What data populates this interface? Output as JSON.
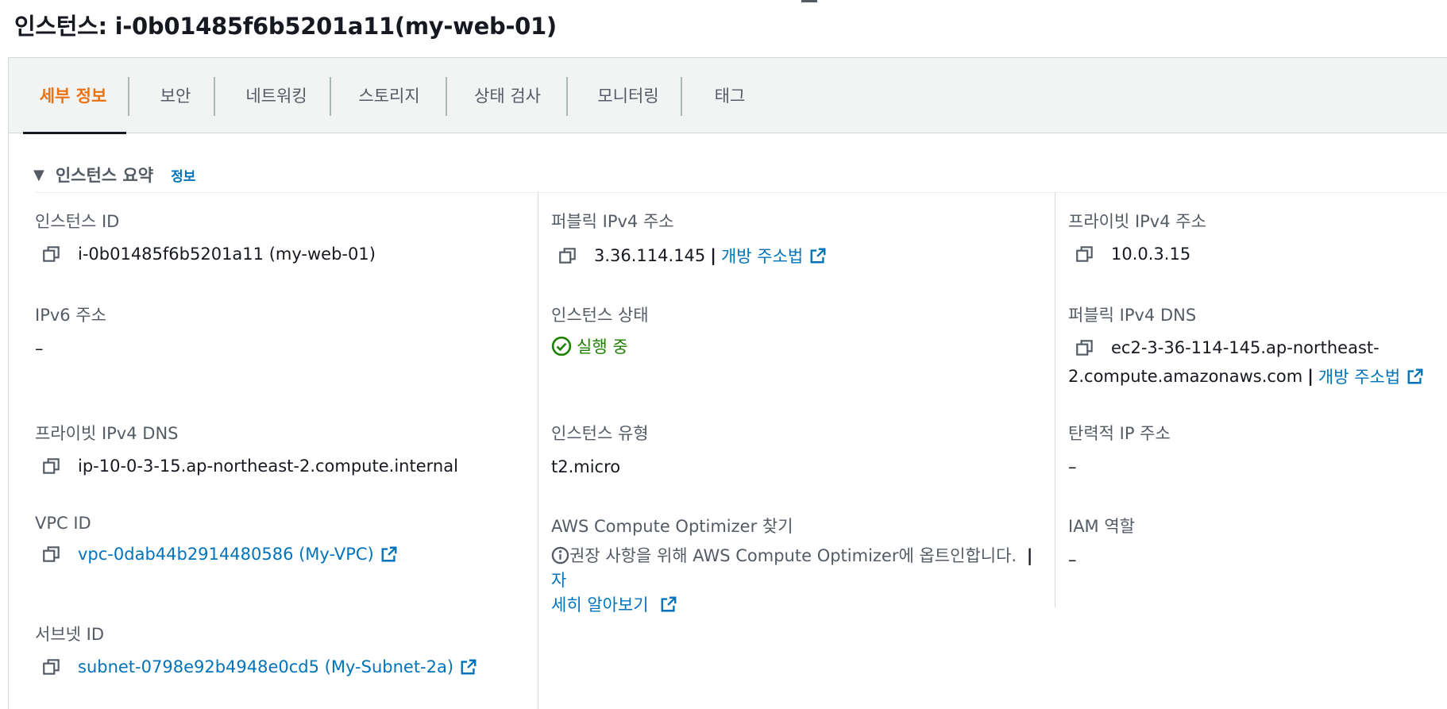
{
  "page": {
    "title": "인스턴스: i-0b01485f6b5201a11(my-web-01)"
  },
  "tabs": [
    {
      "label": "세부 정보",
      "active": true
    },
    {
      "label": "보안"
    },
    {
      "label": "네트워킹"
    },
    {
      "label": "스토리지"
    },
    {
      "label": "상태 검사"
    },
    {
      "label": "모니터링"
    },
    {
      "label": "태그"
    }
  ],
  "summary": {
    "title": "인스턴스 요약",
    "info_link": "정보"
  },
  "fields": {
    "instance_id": {
      "label": "인스턴스 ID",
      "value": "i-0b01485f6b5201a11 (my-web-01)"
    },
    "public_ipv4": {
      "label": "퍼블릭 IPv4 주소",
      "value": "3.36.114.145",
      "sep": "|",
      "link": "개방 주소법"
    },
    "private_ipv4": {
      "label": "프라이빗 IPv4 주소",
      "value": "10.0.3.15"
    },
    "ipv6": {
      "label": "IPv6 주소",
      "value": "–"
    },
    "instance_state": {
      "label": "인스턴스 상태",
      "value": "실행 중"
    },
    "public_dns": {
      "label": "퍼블릭 IPv4 DNS",
      "value_line1": "ec2-3-36-114-145.ap-northeast-",
      "value_line2": "2.compute.amazonaws.com",
      "sep": "|",
      "link": "개방 주소법"
    },
    "private_dns": {
      "label": "프라이빗 IPv4 DNS",
      "value": "ip-10-0-3-15.ap-northeast-2.compute.internal"
    },
    "instance_type": {
      "label": "인스턴스 유형",
      "value": "t2.micro"
    },
    "elastic_ip": {
      "label": "탄력적 IP 주소",
      "value": "–"
    },
    "vpc_id": {
      "label": "VPC ID",
      "value": "vpc-0dab44b2914480586 (My-VPC)"
    },
    "optimizer": {
      "label": "AWS Compute Optimizer 찾기",
      "text": "권장 사항을 위해 AWS Compute Optimizer에 옵트인합니다.",
      "sep": "|",
      "link_part1": "자",
      "link_part2": "세히 알아보기"
    },
    "iam_role": {
      "label": "IAM 역할",
      "value": "–"
    },
    "subnet_id": {
      "label": "서브넷 ID",
      "value": "subnet-0798e92b4948e0cd5 (My-Subnet-2a)"
    }
  },
  "colors": {
    "accent": "#ec7211",
    "link": "#0073bb",
    "success": "#1d8102",
    "text": "#16191f",
    "label": "#545b64"
  },
  "icons": [
    "copy-icon",
    "external-link-icon",
    "check-circle-icon",
    "info-icon",
    "caret-down-icon"
  ]
}
